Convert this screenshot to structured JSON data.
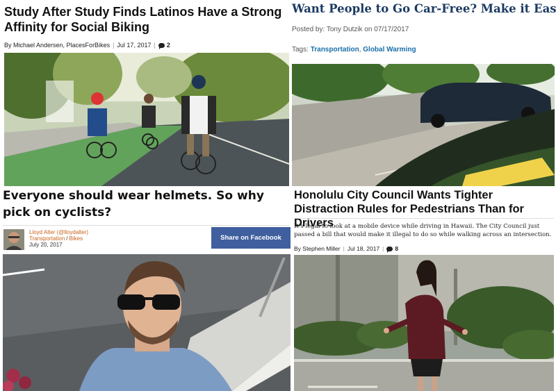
{
  "panels": {
    "top_left": {
      "headline": "Study After Study Finds Latinos Have a Strong Affinity for Social Biking",
      "author": "By Michael Andersen, PlacesForBikes",
      "date": "Jul 17, 2017",
      "comment_count": "2",
      "photo_icon": "comment-bubble-icon"
    },
    "top_right": {
      "headline": "Want People to Go Car-Free? Make it Easier.",
      "posted": "Posted by: Tony Dutzik on 07/17/2017",
      "tags_label": "Tags:",
      "tag_1": "Transportation",
      "tag_separator": ",",
      "tag_2": "Global Warming"
    },
    "bottom_left": {
      "headline": "Everyone should wear helmets. So why pick on cyclists?",
      "author": "Lloyd Alter (@lloydalter)",
      "category_1": "Transportation",
      "category_separator": "/",
      "category_2": "Bikes",
      "date": "July 20, 2017",
      "share_label": "Share on Facebook"
    },
    "bottom_right": {
      "headline": "Honolulu City Council Wants Tighter Distraction Rules for Pedestrians Than for Drivers",
      "dek": "It's legal to look at a mobile device while driving in Hawaii. The City Council just passed a bill that would make it illegal to do so while walking across an intersection.",
      "author": "By Stephen Miller",
      "date": "Jul 18, 2017",
      "comment_count": "8"
    }
  },
  "colors": {
    "tag_link": "#1a6fa8",
    "headline_serif": "#1b3a63",
    "author_link": "#c8631a",
    "facebook_button": "#3f5f9f"
  }
}
